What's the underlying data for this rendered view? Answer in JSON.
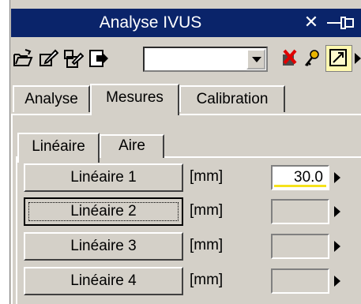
{
  "window": {
    "title": "Analyse IVUS",
    "close_glyph": "✕"
  },
  "toolbar": {
    "icons": [
      "folder-open-icon",
      "edit-icon",
      "edit-copy-icon",
      "export-icon",
      "delete-red-icon",
      "key-icon",
      "zoom-box-icon",
      "more-arrow-icon"
    ],
    "combo_value": ""
  },
  "tabs": [
    {
      "label": "Analyse",
      "active": false
    },
    {
      "label": "Mesures",
      "active": true
    },
    {
      "label": "Calibration",
      "active": false
    }
  ],
  "subtabs": [
    {
      "label": "Linéaire",
      "active": true
    },
    {
      "label": "Aire",
      "active": false
    }
  ],
  "measures": [
    {
      "label": "Linéaire 1",
      "unit": "[mm]",
      "value": "30.0"
    },
    {
      "label": "Linéaire 2",
      "unit": "[mm]",
      "value": ""
    },
    {
      "label": "Linéaire 3",
      "unit": "[mm]",
      "value": ""
    },
    {
      "label": "Linéaire 4",
      "unit": "[mm]",
      "value": ""
    }
  ],
  "colors": {
    "titlebar": "#0a246a",
    "face": "#d4d0c8",
    "value_underline": "#f5e21b"
  }
}
